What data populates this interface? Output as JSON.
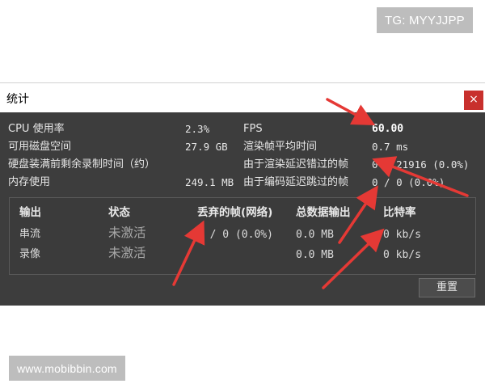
{
  "watermarks": {
    "tg": "TG: MYYJJPP",
    "site": "www.mobibbin.com"
  },
  "window": {
    "title": "统计",
    "close_glyph": "×"
  },
  "stats": {
    "cpu_label": "CPU 使用率",
    "cpu_value": "2.3%",
    "disk_label": "可用磁盘空间",
    "disk_value": "27.9 GB",
    "time_left_label": "硬盘装满前剩余录制时间（约）",
    "time_left_value": "",
    "memory_label": "内存使用",
    "memory_value": "249.1 MB",
    "fps_label": "FPS",
    "fps_value": "60.00",
    "render_time_label": "渲染帧平均时间",
    "render_time_value": "0.7 ms",
    "missed_render_label": "由于渲染延迟错过的帧",
    "missed_render_value": "0 / 21916 (0.0%)",
    "skipped_encode_label": "由于编码延迟跳过的帧",
    "skipped_encode_value": "0 / 0 (0.0%)"
  },
  "outputs": {
    "headers": [
      "输出",
      "状态",
      "丢弃的帧(网络)",
      "总数据输出",
      "比特率"
    ],
    "rows": [
      {
        "name": "串流",
        "status": "未激活",
        "dropped": "0 / 0 (0.0%)",
        "total": "0.0 MB",
        "bitrate": "0 kb/s"
      },
      {
        "name": "录像",
        "status": "未激活",
        "dropped": "",
        "total": "0.0 MB",
        "bitrate": "0 kb/s"
      }
    ]
  },
  "buttons": {
    "reset": "重置"
  },
  "colors": {
    "panel_bg": "#3d3d3d",
    "arrow": "#e53935",
    "close_bg": "#c8302d"
  }
}
